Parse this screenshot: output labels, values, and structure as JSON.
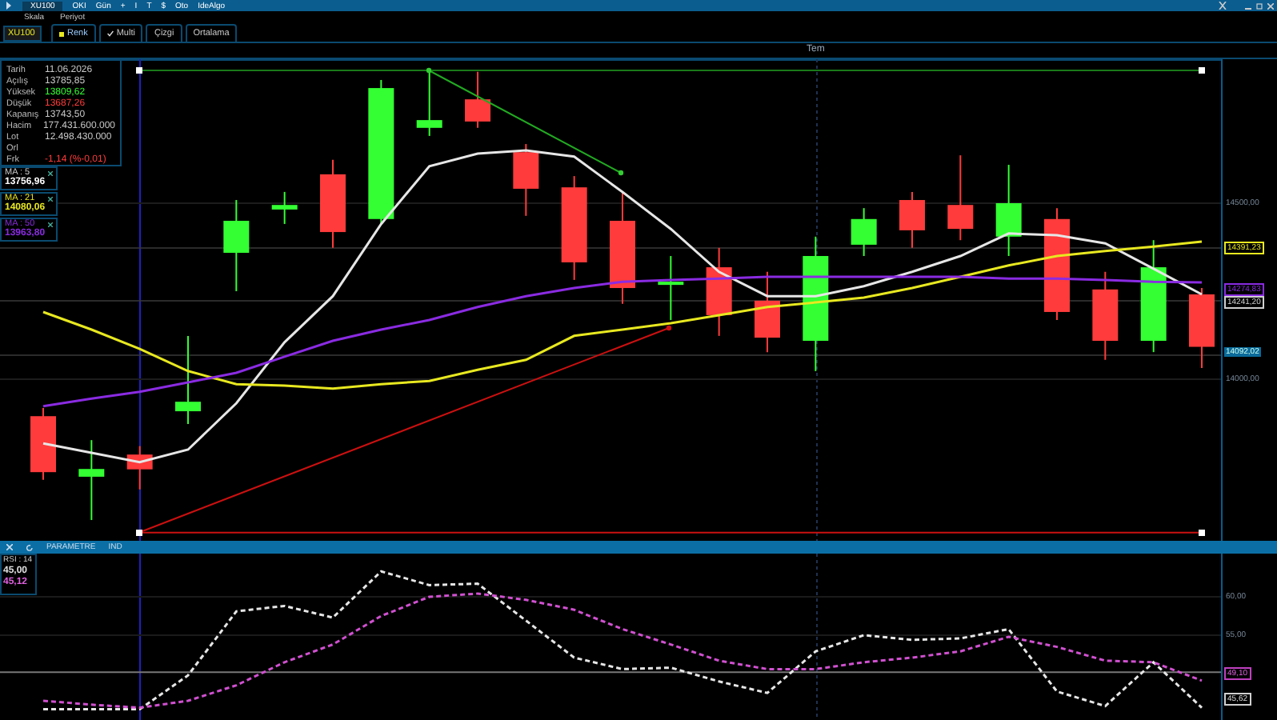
{
  "toolbar": {
    "items": [
      "XU100",
      "OKI",
      "Gün",
      "+",
      "I",
      "T",
      "$",
      "Oto",
      "IdeAlgo"
    ]
  },
  "menu": [
    "Skala",
    "Periyot"
  ],
  "tabs": [
    {
      "label": "XU100",
      "kind": "field"
    },
    {
      "label": "Renk",
      "kind": "color",
      "color": "#e8e820"
    },
    {
      "label": "Multi",
      "kind": "check",
      "checked": true
    },
    {
      "label": "Çizgi",
      "kind": "plain"
    },
    {
      "label": "Ortalama",
      "kind": "plain"
    }
  ],
  "period_label": "Tem",
  "info": [
    {
      "label": "Tarih",
      "value": "11.06.2026",
      "color": "#c8c8c8"
    },
    {
      "label": "Açılış",
      "value": "13785,85",
      "color": "#c8c8c8"
    },
    {
      "label": "Yüksek",
      "value": "13809,62",
      "color": "#33ff33"
    },
    {
      "label": "Düşük",
      "value": "13687,26",
      "color": "#ff3b3b"
    },
    {
      "label": "Kapanış",
      "value": "13743,50",
      "color": "#c8c8c8"
    },
    {
      "label": "Hacim",
      "value": "177.431.600.000",
      "color": "#c8c8c8"
    },
    {
      "label": "Lot",
      "value": "12.498.430.000",
      "color": "#c8c8c8"
    },
    {
      "label": "Orl"
    },
    {
      "label": "Frk",
      "value": "-1,14 (%-0,01)",
      "color": "#ff3b3b"
    }
  ],
  "moving_averages": [
    {
      "label": "MA : 5",
      "value": "13756,96",
      "color": "#ffffff"
    },
    {
      "label": "MA : 21",
      "value": "14080,06",
      "color": "#e8e820"
    },
    {
      "label": "MA : 50",
      "value": "13963,80",
      "color": "#8a2be2"
    }
  ],
  "price_chart": {
    "chart_data": {
      "type": "candlestick",
      "ohlc": [
        [
          13895,
          13918,
          13714,
          13736
        ],
        [
          13723,
          13827,
          13600,
          13745
        ],
        [
          13786,
          13810,
          13687,
          13744
        ],
        [
          13909,
          14123,
          13873,
          13936
        ],
        [
          14359,
          14509,
          14250,
          14450
        ],
        [
          14482,
          14532,
          14441,
          14495
        ],
        [
          14582,
          14623,
          14373,
          14418
        ],
        [
          14455,
          14850,
          14441,
          14827
        ],
        [
          14714,
          14873,
          14691,
          14736
        ],
        [
          14795,
          14873,
          14714,
          14732
        ],
        [
          14645,
          14668,
          14464,
          14541
        ],
        [
          14545,
          14577,
          14282,
          14332
        ],
        [
          14450,
          14532,
          14214,
          14259
        ],
        [
          14268,
          14350,
          14168,
          14277
        ],
        [
          14318,
          14373,
          14123,
          14182
        ],
        [
          14223,
          14305,
          14077,
          14118
        ],
        [
          14109,
          14405,
          14023,
          14350
        ],
        [
          14382,
          14486,
          14350,
          14455
        ],
        [
          14509,
          14532,
          14373,
          14423
        ],
        [
          14495,
          14636,
          14395,
          14427
        ],
        [
          14405,
          14609,
          14350,
          14500
        ],
        [
          14455,
          14486,
          14168,
          14191
        ],
        [
          14255,
          14305,
          14055,
          14109
        ],
        [
          14109,
          14395,
          14077,
          14318
        ],
        [
          14241,
          14259,
          14032,
          14092
        ]
      ],
      "ref_lines": [
        {
          "axis": "y",
          "value": 14877,
          "color": "#1a7a1a"
        },
        {
          "axis": "y",
          "value": 13564,
          "color": "#cc1010"
        }
      ],
      "categories": [
        null,
        null,
        null,
        null,
        null,
        null,
        null,
        null,
        null,
        null,
        null,
        null,
        null,
        null,
        null,
        null,
        null,
        null,
        null,
        null,
        null,
        null,
        null,
        null,
        null
      ],
      "ylim": [
        13541,
        14909
      ],
      "yticks": [
        {
          "value": 14500,
          "label": "14500,00"
        },
        {
          "value": 14000,
          "label": "14000,00"
        }
      ],
      "series": [
        {
          "type": "line",
          "color": "#e6e6e6",
          "values": [
            13818,
            13791,
            13764,
            13800,
            13932,
            14105,
            14236,
            14441,
            14605,
            14641,
            14650,
            14632,
            14532,
            14427,
            14305,
            14236,
            14236,
            14264,
            14305,
            14350,
            14414,
            14409,
            14386,
            14314,
            14241
          ]
        },
        {
          "type": "line",
          "color": "#e8e820",
          "values": [
            14191,
            14141,
            14086,
            14023,
            13986,
            13982,
            13973,
            13986,
            13995,
            14027,
            14055,
            14123,
            14141,
            14159,
            14182,
            14205,
            14218,
            14232,
            14259,
            14291,
            14323,
            14350,
            14364,
            14377,
            14391
          ]
        },
        {
          "type": "line",
          "color": "#8a2be2",
          "values": [
            13923,
            13945,
            13964,
            13991,
            14018,
            14064,
            14109,
            14141,
            14168,
            14205,
            14236,
            14259,
            14277,
            14282,
            14286,
            14291,
            14291,
            14291,
            14291,
            14291,
            14286,
            14286,
            14282,
            14277,
            14275
          ]
        }
      ]
    }
  },
  "price_axis": [
    {
      "label": "14391,23",
      "kind": "tag",
      "color": "#e8e820"
    },
    {
      "label": "14274,83",
      "kind": "tag",
      "color": "#8a2be2"
    },
    {
      "label": "14241,20",
      "kind": "tag",
      "color": "#d0d0d0"
    },
    {
      "label": "14092,02",
      "kind": "fill",
      "color": "#0a6a9a"
    }
  ],
  "indicator_bar": {
    "items": [
      "PARAMETRE",
      "IND"
    ]
  },
  "rsi": {
    "label": "RSI : 14",
    "values": [
      {
        "value": "45,00",
        "color": "#e0e0e0"
      },
      {
        "value": "45,12",
        "color": "#e060e0"
      }
    ]
  },
  "rsi_chart": {
    "chart_data": {
      "type": "line",
      "categories": [
        null,
        null,
        null,
        null,
        null,
        null,
        null,
        null,
        null,
        null,
        null,
        null,
        null,
        null,
        null,
        null,
        null,
        null,
        null,
        null,
        null,
        null,
        null,
        null,
        null
      ],
      "ylim": [
        44.0,
        65.6
      ],
      "yticks": [
        {
          "value": 60,
          "label": "60,00"
        },
        {
          "value": 55,
          "label": "55,00"
        }
      ],
      "ref_lines": [
        {
          "axis": "y",
          "value": 50.2,
          "color": "#777777"
        }
      ],
      "series": [
        {
          "color": "#e6e6e6",
          "line_style": "dashed",
          "values": [
            45.4,
            45.4,
            45.4,
            49.8,
            58.1,
            58.8,
            57.3,
            63.3,
            61.5,
            61.7,
            56.9,
            52.1,
            50.6,
            50.8,
            49.0,
            47.5,
            52.9,
            55.0,
            54.4,
            54.6,
            55.8,
            47.7,
            45.8,
            51.5,
            45.6
          ]
        },
        {
          "color": "#d050d0",
          "line_style": "dashed",
          "values": [
            46.5,
            46.0,
            45.6,
            46.5,
            48.5,
            51.5,
            53.8,
            57.5,
            60.0,
            60.4,
            59.6,
            58.3,
            55.8,
            53.8,
            51.7,
            50.6,
            50.6,
            51.5,
            52.1,
            52.9,
            54.8,
            53.5,
            51.7,
            51.5,
            49.1
          ]
        }
      ]
    }
  },
  "rsi_axis": [
    {
      "label": "49,10",
      "kind": "tag",
      "color": "#c040c0"
    },
    {
      "label": "45,62",
      "kind": "tag",
      "color": "#d0d0d0"
    }
  ]
}
